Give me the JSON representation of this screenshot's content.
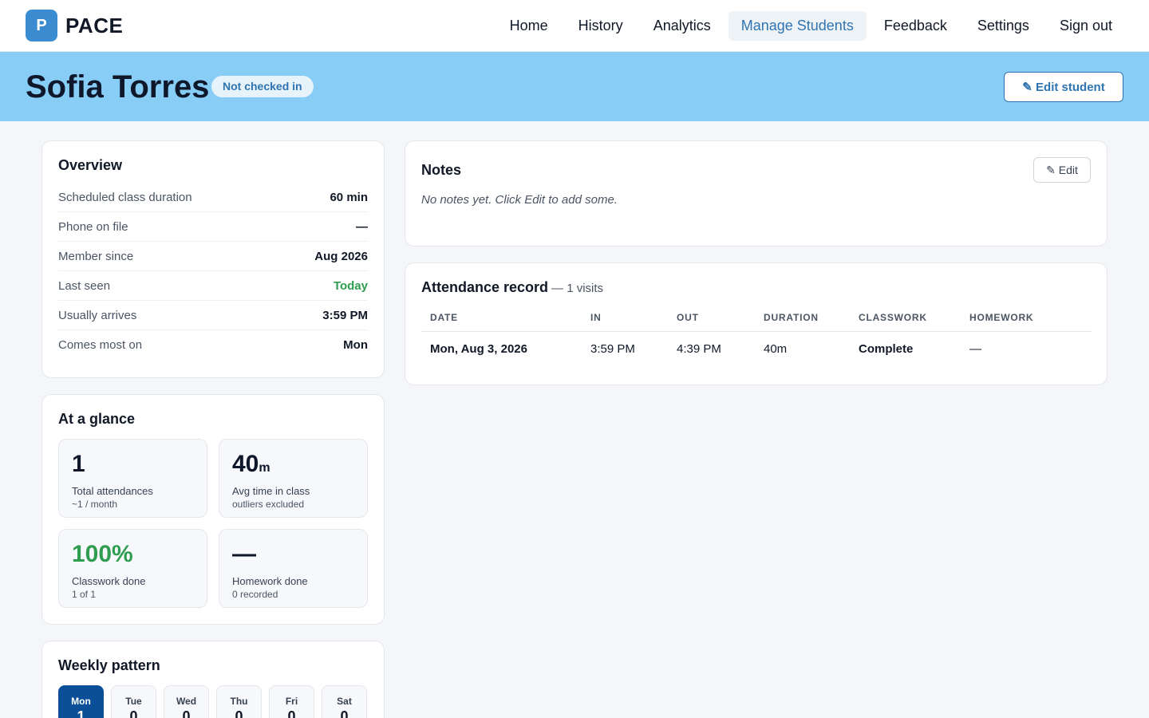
{
  "app": {
    "logo_letter": "P",
    "name": "PACE"
  },
  "nav": [
    {
      "label": "Home",
      "active": false
    },
    {
      "label": "History",
      "active": false
    },
    {
      "label": "Analytics",
      "active": false
    },
    {
      "label": "Manage Students",
      "active": true
    },
    {
      "label": "Feedback",
      "active": false
    },
    {
      "label": "Settings",
      "active": false
    },
    {
      "label": "Sign out",
      "active": false
    }
  ],
  "student": {
    "name": "Sofia Torres",
    "status": "Not checked in",
    "edit_label": "✎ Edit student"
  },
  "overview": {
    "title": "Overview",
    "rows": [
      {
        "label": "Scheduled class duration",
        "value": "60 min"
      },
      {
        "label": "Phone on file",
        "value": "—"
      },
      {
        "label": "Member since",
        "value": "Aug 2026"
      },
      {
        "label": "Last seen",
        "value": "Today"
      },
      {
        "label": "Usually arrives",
        "value": "3:59 PM"
      },
      {
        "label": "Comes most on",
        "value": "Mon"
      }
    ]
  },
  "glance": {
    "title": "At a glance",
    "tiles": [
      {
        "value": "1",
        "unit": "",
        "label": "Total attendances",
        "sub": "~1 / month"
      },
      {
        "value": "40",
        "unit": "m",
        "label": "Avg time in class",
        "sub": "outliers excluded"
      },
      {
        "value": "100%",
        "unit": "",
        "label": "Classwork done",
        "sub": "1 of 1"
      },
      {
        "value": "—",
        "unit": "",
        "label": "Homework done",
        "sub": "0 recorded"
      }
    ]
  },
  "weekly": {
    "title": "Weekly pattern",
    "days": [
      {
        "name": "Mon",
        "count": "1",
        "active": true
      },
      {
        "name": "Tue",
        "count": "0",
        "active": false
      },
      {
        "name": "Wed",
        "count": "0",
        "active": false
      },
      {
        "name": "Thu",
        "count": "0",
        "active": false
      },
      {
        "name": "Fri",
        "count": "0",
        "active": false
      },
      {
        "name": "Sat",
        "count": "0",
        "active": false
      }
    ]
  },
  "notes": {
    "title": "Notes",
    "edit_label": "✎ Edit",
    "empty": "No notes yet. Click Edit to add some."
  },
  "attendance": {
    "title": "Attendance record",
    "count_text": "— 1 visits",
    "columns": [
      "DATE",
      "IN",
      "OUT",
      "DURATION",
      "CLASSWORK",
      "HOMEWORK"
    ],
    "rows": [
      {
        "date": "Mon, Aug 3, 2026",
        "in": "3:59 PM",
        "out": "4:39 PM",
        "duration": "40m",
        "classwork": "Complete",
        "homework": "—"
      }
    ]
  },
  "colors": {
    "accent": "#2f74b0",
    "hero": "#87cdf5",
    "success": "#2e9d4f",
    "active_day": "#0b4f99"
  }
}
